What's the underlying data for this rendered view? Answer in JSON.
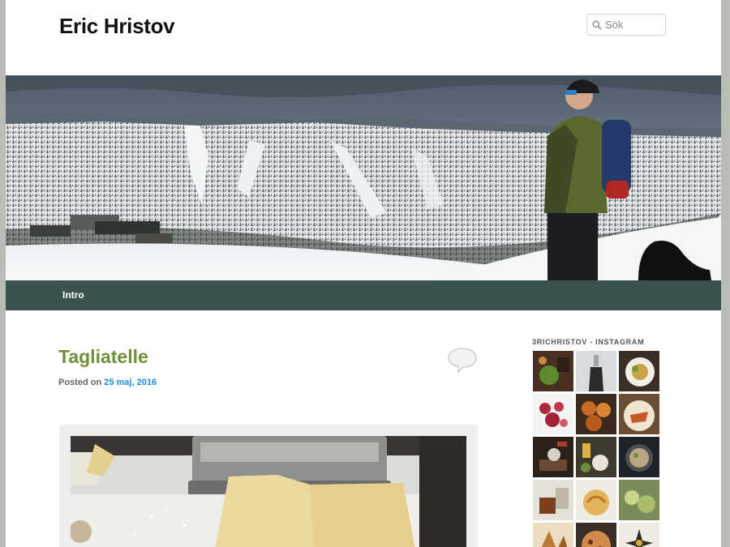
{
  "site": {
    "title": "Eric Hristov"
  },
  "search": {
    "placeholder": "Sök",
    "icon": "search-icon"
  },
  "nav": {
    "items": [
      {
        "label": "Intro"
      }
    ]
  },
  "post": {
    "title": "Tagliatelle",
    "posted_label": "Posted on",
    "date": "25 maj, 2016"
  },
  "sidebar": {
    "widget_title": "3RICHRISTOV - INSTAGRAM",
    "instagram_thumbnails": 15
  },
  "colors": {
    "page_background": "#b9bdb6",
    "nav_background": "#3a5350",
    "post_title": "#6f8f3a",
    "link": "#1b8be0"
  }
}
